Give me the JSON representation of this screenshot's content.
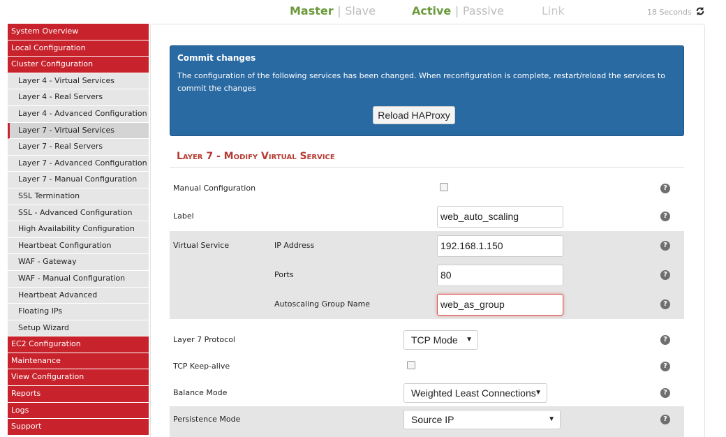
{
  "status": {
    "master": "Master",
    "slave": "Slave",
    "active": "Active",
    "passive": "Passive",
    "link": "Link",
    "sep": "|",
    "refresh": "18 Seconds"
  },
  "sidebar": {
    "items": [
      {
        "label": "System Overview"
      },
      {
        "label": "Local Configuration"
      },
      {
        "label": "Cluster Configuration"
      },
      {
        "label": "Layer 4 - Virtual Services"
      },
      {
        "label": "Layer 4 - Real Servers"
      },
      {
        "label": "Layer 4 - Advanced Configuration"
      },
      {
        "label": "Layer 7 - Virtual Services"
      },
      {
        "label": "Layer 7 - Real Servers"
      },
      {
        "label": "Layer 7 - Advanced Configuration"
      },
      {
        "label": "Layer 7 - Manual Configuration"
      },
      {
        "label": "SSL Termination"
      },
      {
        "label": "SSL - Advanced Configuration"
      },
      {
        "label": "High Availability Configuration"
      },
      {
        "label": "Heartbeat Configuration"
      },
      {
        "label": "WAF - Gateway"
      },
      {
        "label": "WAF - Manual Configuration"
      },
      {
        "label": "Heartbeat Advanced"
      },
      {
        "label": "Floating IPs"
      },
      {
        "label": "Setup Wizard"
      },
      {
        "label": "EC2 Configuration"
      },
      {
        "label": "Maintenance"
      },
      {
        "label": "View Configuration"
      },
      {
        "label": "Reports"
      },
      {
        "label": "Logs"
      },
      {
        "label": "Support"
      }
    ]
  },
  "commit": {
    "title": "Commit changes",
    "message": "The configuration of the following services has been changed. When reconfiguration is complete, restart/reload the services to commit the changes",
    "button": "Reload HAProxy"
  },
  "form": {
    "title": "Layer 7 - Modify Virtual Service",
    "manual_config_label": "Manual Configuration",
    "label_label": "Label",
    "label_value": "web_auto_scaling",
    "virtual_service_label": "Virtual Service",
    "ip_label": "IP Address",
    "ip_value": "192.168.1.150",
    "ports_label": "Ports",
    "ports_value": "80",
    "asg_label": "Autoscaling Group Name",
    "asg_value": "web_as_group",
    "protocol_label": "Layer 7 Protocol",
    "protocol_value": "TCP Mode",
    "keepalive_label": "TCP Keep-alive",
    "balance_label": "Balance Mode",
    "balance_value": "Weighted Least Connections",
    "persistence_label": "Persistence Mode",
    "persistence_value": "Source IP",
    "help": "?"
  }
}
